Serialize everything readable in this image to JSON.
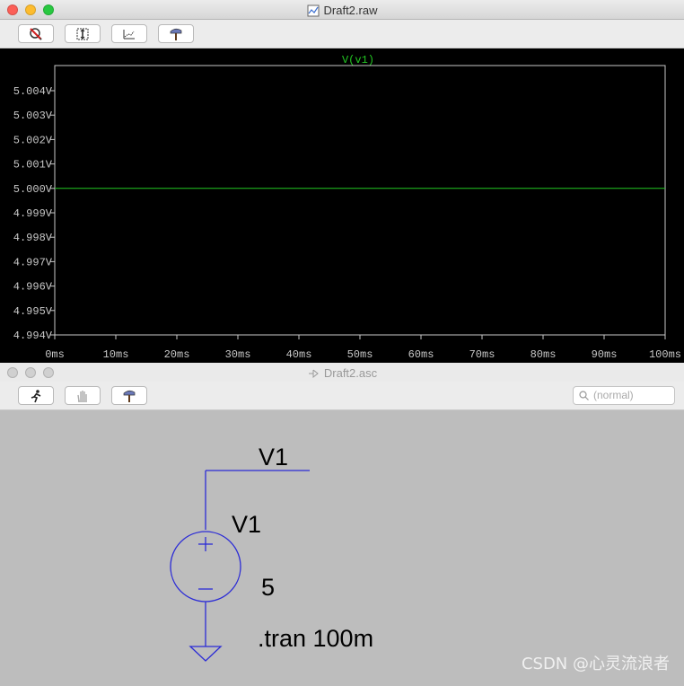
{
  "plot_window": {
    "title": "Draft2.raw",
    "trace_label": "V(v1)",
    "colors": {
      "trace": "#22c722",
      "axis": "#c8c8c8",
      "background": "#000000"
    },
    "toolbar_icons": [
      "zoom-cancel-icon",
      "autoscale-icon",
      "pan-icon",
      "hammer-icon"
    ]
  },
  "chart_data": {
    "type": "line",
    "title": "V(v1)",
    "xlabel": "",
    "ylabel": "",
    "x_ticks": [
      "0ms",
      "10ms",
      "20ms",
      "30ms",
      "40ms",
      "50ms",
      "60ms",
      "70ms",
      "80ms",
      "90ms",
      "100ms"
    ],
    "y_ticks": [
      "5.004V",
      "5.003V",
      "5.002V",
      "5.001V",
      "5.000V",
      "4.999V",
      "4.998V",
      "4.997V",
      "4.996V",
      "4.995V",
      "4.994V"
    ],
    "xlim": [
      0,
      100
    ],
    "ylim": [
      4.994,
      5.004
    ],
    "series": [
      {
        "name": "V(v1)",
        "x": [
          0,
          100
        ],
        "y": [
          5.0,
          5.0
        ]
      }
    ]
  },
  "schematic_window": {
    "title": "Draft2.asc",
    "search_placeholder": "(normal)",
    "toolbar_icons": [
      "run-icon",
      "hand-icon",
      "hammer-icon"
    ],
    "net_label": "V1",
    "source_name": "V1",
    "source_value": "5",
    "directive": ".tran 100m",
    "wire_color": "#2b2bd6"
  },
  "watermark": "CSDN @心灵流浪者"
}
